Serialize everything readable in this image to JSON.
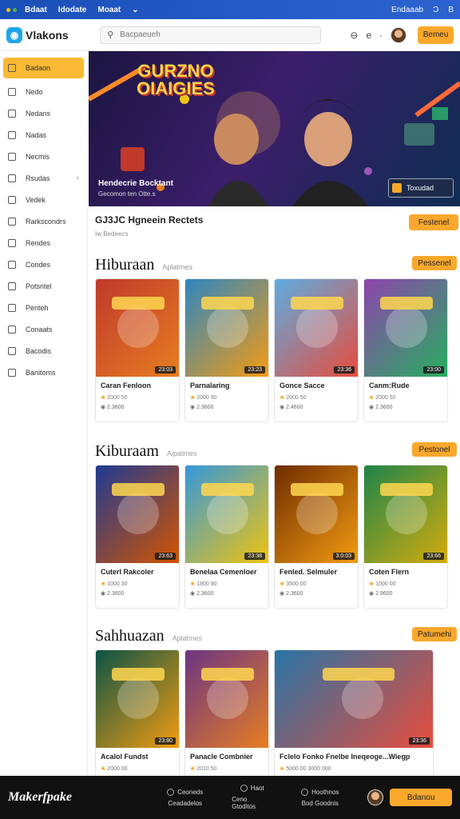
{
  "topbar": {
    "links": [
      "Bdaat",
      "Idodate",
      "Moaat"
    ],
    "right": [
      "Endaaab",
      "Ɔ",
      "B"
    ]
  },
  "header": {
    "logo": "Vlakons",
    "search_placeholder": "Bacpaeueh",
    "icon_text": "e",
    "cta": "Bemeu"
  },
  "sidebar": {
    "items": [
      {
        "label": "Badaon"
      },
      {
        "label": "Nedo"
      },
      {
        "label": "Nedans"
      },
      {
        "label": "Nadas"
      },
      {
        "label": "Necmis"
      },
      {
        "label": "Rsudas"
      },
      {
        "label": "Vedek"
      },
      {
        "label": "Rarkscondrs"
      },
      {
        "label": "Rendes"
      },
      {
        "label": "Condes"
      },
      {
        "label": "Potsntel"
      },
      {
        "label": "Penteh"
      },
      {
        "label": "Conaats"
      },
      {
        "label": "Bacodis"
      },
      {
        "label": "Banitoms"
      }
    ]
  },
  "hero": {
    "title_line1": "GURZNO",
    "title_line2": "OIAIGIES",
    "caption": "Hendecrie Bocktant",
    "subcaption": "Gecomon ten Otte.s",
    "button": "Toxudad"
  },
  "featured": {
    "title": "GJ3JC Hgneein Rectets",
    "subtitle": "Iw Bedeecs",
    "button": "Festenel"
  },
  "sections": [
    {
      "title": "Hiburaan",
      "subtitle": "Aplatmes",
      "button": "Pessenel",
      "cards": [
        {
          "name": "Caran Fenloon",
          "badge": "23:03",
          "rating": "2000 50",
          "views": "2.3600"
        },
        {
          "name": "Parnalaring",
          "badge": "23:23",
          "rating": "2000 90",
          "views": "2.3600"
        },
        {
          "name": "Gonce Sacce",
          "badge": "23:36",
          "rating": "2000 50",
          "views": "2.4600"
        },
        {
          "name": "Canm:Rude",
          "badge": "23:00",
          "rating": "2000 50",
          "views": "2.3600"
        }
      ]
    },
    {
      "title": "Kiburaam",
      "subtitle": "Aipatmes",
      "button": "Pestonel",
      "cards": [
        {
          "name": "Cuterl Rakcoler",
          "badge": "23:63",
          "rating": "1000 30",
          "views": "2.3600"
        },
        {
          "name": "Benelaa Cemenloer",
          "badge": "23:38",
          "rating": "1800 90",
          "views": "2.3600"
        },
        {
          "name": "Fenled. Selmuler",
          "badge": "3:0:03",
          "rating": "3500 00",
          "views": "2.3600"
        },
        {
          "name": "Coten Flern",
          "badge": "23:66",
          "rating": "1000 00",
          "views": "2.9600"
        }
      ]
    },
    {
      "title": "Sahhuazan",
      "subtitle": "Aplatmes",
      "button": "Patumehi",
      "cards": [
        {
          "name": "Acalol Fundst",
          "badge": "23:80",
          "rating": "2000 00",
          "views": ""
        },
        {
          "name": "Panacle Combnier",
          "badge": "",
          "rating": "2010 50",
          "views": ""
        },
        {
          "name": "Fclelo Fonko Fnelbe Ineqeoge...Wiegp",
          "badge": "23:36",
          "rating": "5000 00 3000 000",
          "views": ""
        }
      ]
    }
  ],
  "footer": {
    "logo": "Makerfpake",
    "links": [
      {
        "a": "Ceoneds",
        "b": "Ceadadelos"
      },
      {
        "a": "Haot",
        "b": "Ceno Gtoditos"
      },
      {
        "a": "Hoothnos",
        "b": "Bod Goodnis"
      }
    ],
    "cta": "Bdanou"
  }
}
